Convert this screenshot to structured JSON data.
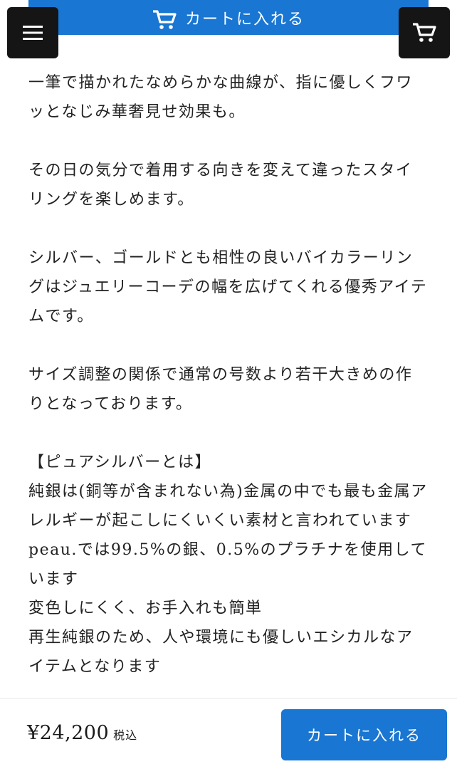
{
  "header": {
    "top_cart_button_label": "カートに入れる",
    "menu_icon": "hamburger-menu-icon",
    "cart_icon": "shopping-cart-icon"
  },
  "content": {
    "paragraphs": [
      "一筆で描かれたなめらかな曲線が、指に優しくフワッとなじみ華奢見せ効果も。",
      "その日の気分で着用する向きを変えて違ったスタイリングを楽しめます。",
      "シルバー、ゴールドとも相性の良いバイカラーリングはジュエリーコーデの幅を広げてくれる優秀アイテムです。",
      "サイズ調整の関係で通常の号数より若干大きめの作りとなっております。"
    ],
    "pure_silver": {
      "heading": "【ピュアシルバーとは】",
      "lines": [
        "純銀は(銅等が含まれない為)金属の中でも最も金属アレルギーが起こしにくいくい素材と言われています",
        "peau.では99.5%の銀、0.5%のプラチナを使用しています",
        "変色しにくく、お手入れも簡単",
        "再生純銀のため、人や環境にも優しいエシカルなアイテムとなります"
      ]
    }
  },
  "footer": {
    "price": "¥24,200",
    "tax_label": "税込",
    "cart_button_label": "カートに入れる"
  },
  "colors": {
    "accent": "#1976d2",
    "icon_button_bg": "#151515",
    "text": "#222222"
  }
}
